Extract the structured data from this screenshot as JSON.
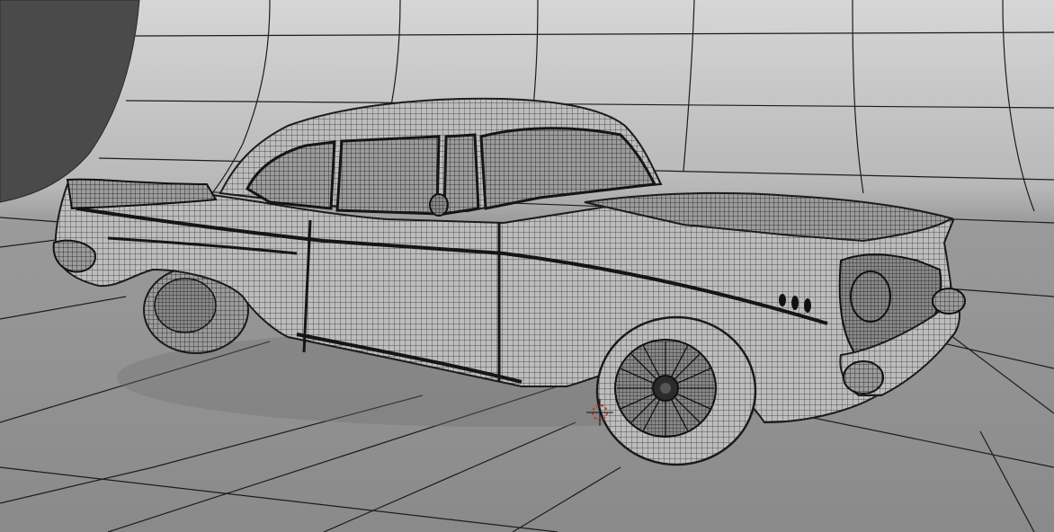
{
  "viewport": {
    "mode": "wireframe-on-shaded",
    "colors": {
      "background_top": "#d4d4d4",
      "background_bottom": "#8e8e8e",
      "floor": "#8c8c8c",
      "grid_line": "#1c1c1c",
      "mesh_fill": "#b9b9b9",
      "mesh_wire": "#2a2a2a",
      "dark_object": "#4a4a4a",
      "cursor": "#c0392b"
    },
    "objects": [
      {
        "name": "car-body-mesh",
        "icon": "mesh-icon"
      },
      {
        "name": "backdrop-cyclorama-plane",
        "icon": "plane-icon"
      },
      {
        "name": "dark-sphere-object",
        "icon": "sphere-icon"
      }
    ]
  }
}
